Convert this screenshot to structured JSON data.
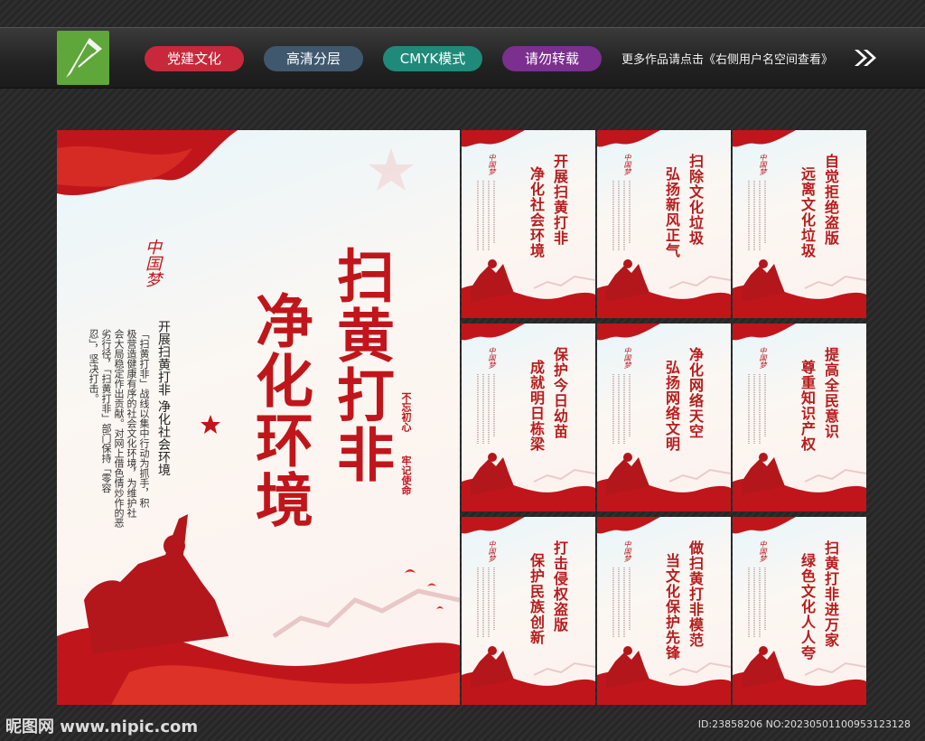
{
  "toolbar": {
    "tags": [
      {
        "label": "党建文化",
        "color": "#c8283a"
      },
      {
        "label": "高清分层",
        "color": "#40586e"
      },
      {
        "label": "CMYK模式",
        "color": "#1f8a7a"
      },
      {
        "label": "请勿转载",
        "color": "#7b2f8e"
      }
    ],
    "notice": "更多作品请点击《右侧用户名空间查看》"
  },
  "main_poster": {
    "title_line1": "扫黄打非",
    "title_line2": "净化环境",
    "subtitle": "开展扫黄打非  净化社会环境",
    "body_col1": "「扫黄打非」战线以集中行动为抓手，积",
    "body_col2": "极营造健康有序的社会文化环境，为维护社",
    "body_col3": "会大局稳定作出贡献。对网上借色情炒作的恶",
    "body_col4": "劣行径，「扫黄打非」部门保持「零容",
    "body_col5": "忍」，坚决打击。",
    "slogan1": "不忘初心",
    "slogan2": "牢记使命"
  },
  "posters": [
    {
      "t1": "开展扫黄打非",
      "t2": "净化社会环境"
    },
    {
      "t1": "扫除文化垃圾",
      "t2": "弘扬新风正气"
    },
    {
      "t1": "自觉拒绝盗版",
      "t2": "远离文化垃圾"
    },
    {
      "t1": "保护今日幼苗",
      "t2": "成就明日栋梁"
    },
    {
      "t1": "净化网络天空",
      "t2": "弘扬网络文明"
    },
    {
      "t1": "提高全民意识",
      "t2": "尊重知识产权"
    },
    {
      "t1": "打击侵权盗版",
      "t2": "保护民族创新"
    },
    {
      "t1": "做扫黄打非模范",
      "t2": "当文化保护先锋"
    },
    {
      "t1": "扫黄打非进万家",
      "t2": "绿色文化人人夸"
    }
  ],
  "footer": {
    "site": "昵图网 www.nipic.com",
    "id": "ID:23858206 NO:20230501100953123128"
  },
  "colors": {
    "accent_red": "#c0161b",
    "dark_red": "#a50f14"
  }
}
